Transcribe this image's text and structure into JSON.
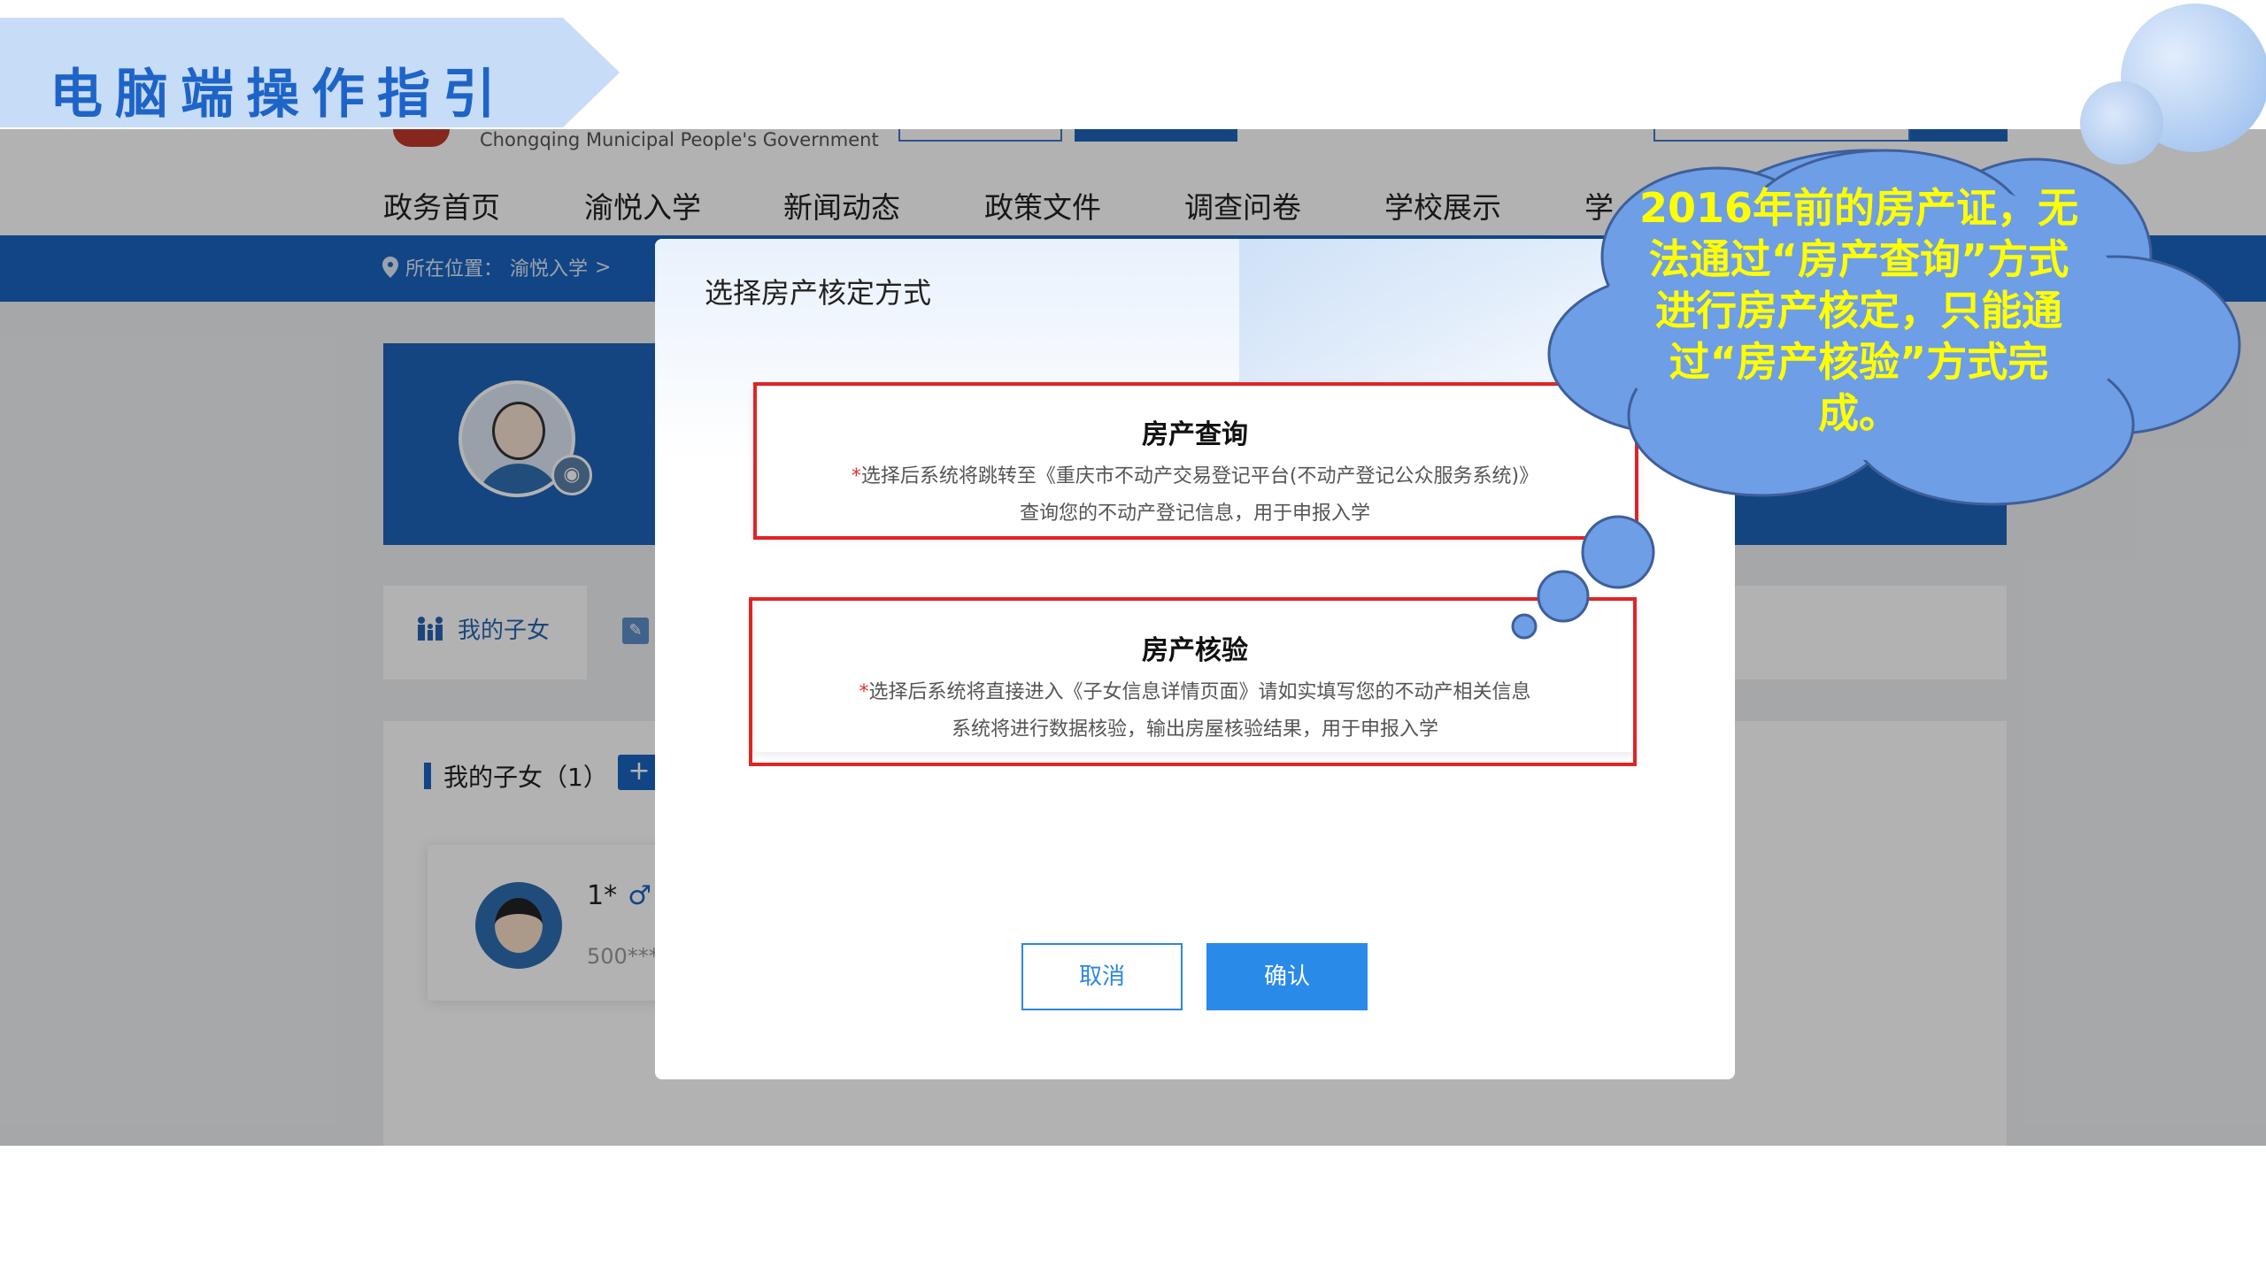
{
  "slide": {
    "title": "电脑端操作指引",
    "callout": "2016年前的房产证，无法通过“房产查询”方式进行房产核定，只能通过“房产核验”方式完成。"
  },
  "site": {
    "header": {
      "subtitle": "Chongqing Municipal People's Government"
    },
    "nav": [
      "政务首页",
      "渝悦入学",
      "新闻动态",
      "政策文件",
      "调查问卷",
      "学校展示",
      "学"
    ],
    "breadcrumb": {
      "label": "所在位置：",
      "current": "渝悦入学",
      "separator": ">"
    },
    "tabs": {
      "children": "我的子女"
    },
    "children_section": {
      "title": "我的子女（1）",
      "add_label": "+",
      "child": {
        "name": "1*",
        "gender": "♂",
        "id": "500***"
      }
    }
  },
  "modal": {
    "title": "选择房产核定方式",
    "options": [
      {
        "title": "房产查询",
        "required_mark": "*",
        "line1": "选择后系统将跳转至《重庆市不动产交易登记平台(不动产登记公众服务系统)》",
        "line2": "查询您的不动产登记信息，用于申报入学"
      },
      {
        "title": "房产核验",
        "required_mark": "*",
        "line1": "选择后系统将直接进入《子女信息详情页面》请如实填写您的不动产相关信息",
        "line2": "系统将进行数据核验，输出房屋核验结果，用于申报入学"
      }
    ],
    "cancel_label": "取消",
    "confirm_label": "确认"
  },
  "colors": {
    "brand_blue": "#1a63bf",
    "confirm_blue": "#2a8ae8",
    "annotation_red": "#e02424",
    "callout_text": "#ffff00",
    "cloud_fill": "#6d9ee6",
    "banner_fill": "#c7dcf6"
  }
}
